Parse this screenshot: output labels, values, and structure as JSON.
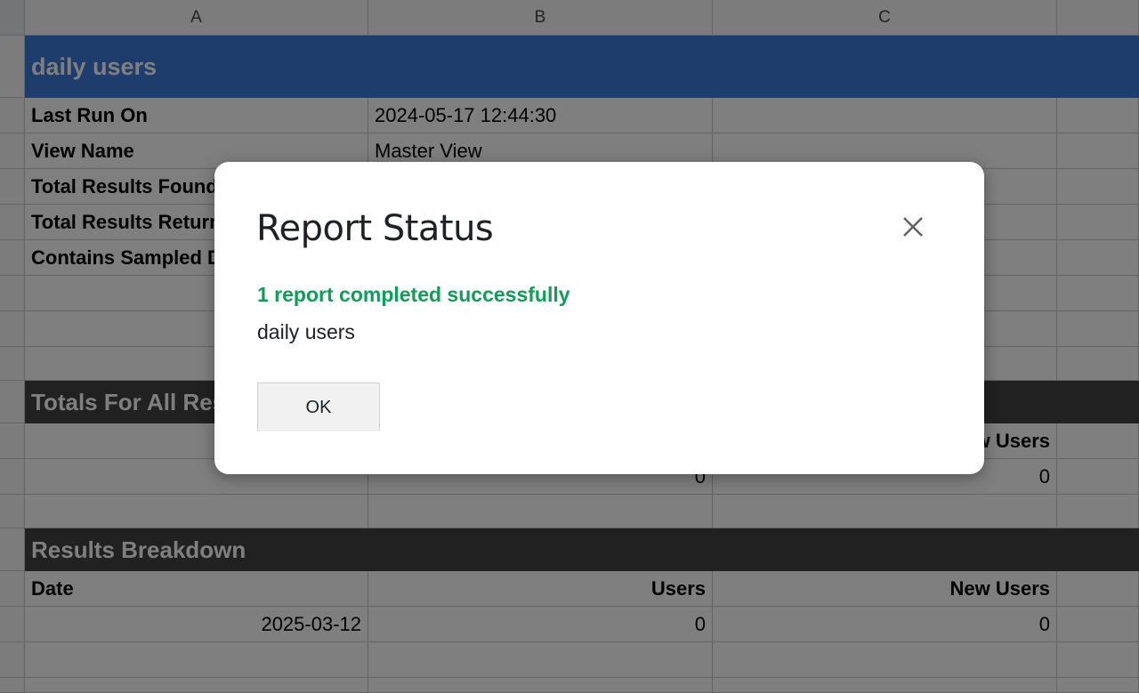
{
  "sheet": {
    "columns": [
      "A",
      "B",
      "C"
    ],
    "title": "daily users",
    "meta": {
      "last_run_label": "Last Run On",
      "last_run_value": "2024-05-17 12:44:30",
      "view_name_label": "View Name",
      "view_name_value": "Master View",
      "total_found_label": "Total Results Found",
      "total_returned_label": "Total Results Returned",
      "sampled_label": "Contains Sampled Data"
    },
    "totals": {
      "header": "Totals For All Results",
      "col_c_header": "New Users",
      "col_b_value": "0",
      "col_c_value": "0"
    },
    "breakdown": {
      "header": "Results Breakdown",
      "columns": [
        "Date",
        "Users",
        "New Users"
      ],
      "rows": [
        [
          "2025-03-12",
          "0",
          "0"
        ]
      ]
    }
  },
  "dialog": {
    "title": "Report Status",
    "success_message": "1 report completed successfully",
    "report_name": "daily users",
    "ok_label": "OK",
    "close_icon": "close-icon"
  },
  "colors": {
    "title_band": "#3c78d8",
    "section_band": "#434343",
    "success": "#0f9d58"
  }
}
